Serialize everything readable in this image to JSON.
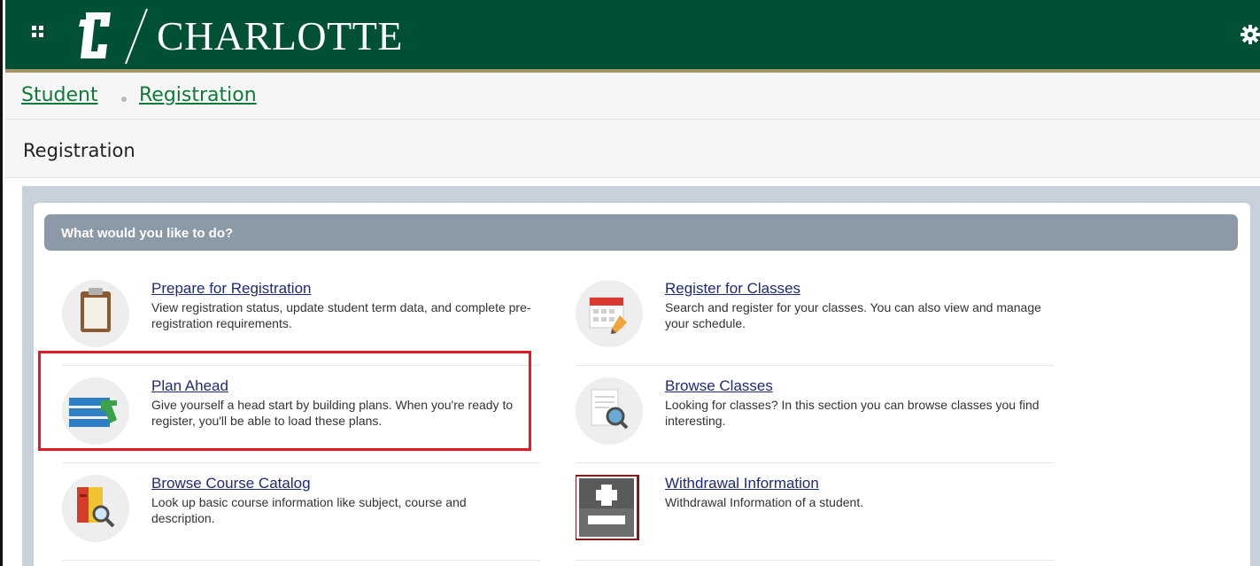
{
  "header": {
    "brand": "CHARLOTTE",
    "grid_icon": "app-grid-icon",
    "logo_icon": "university-c-logo-icon",
    "settings_icon": "gear-icon"
  },
  "breadcrumb": {
    "items": [
      {
        "label": "Student"
      },
      {
        "label": "Registration"
      }
    ]
  },
  "page": {
    "title": "Registration"
  },
  "section": {
    "title": "What would you like to do?"
  },
  "options": [
    {
      "label": "Prepare for Registration",
      "desc": "View registration status, update student term data, and complete pre-registration requirements.",
      "icon": "clipboard-icon"
    },
    {
      "label": "Register for Classes",
      "desc": "Search and register for your classes. You can also view and manage your schedule.",
      "icon": "calendar-pencil-icon"
    },
    {
      "label": "Plan Ahead",
      "desc": "Give yourself a head start by building plans. When you're ready to register, you'll be able to load these plans.",
      "icon": "plan-list-icon"
    },
    {
      "label": "Browse Classes",
      "desc": "Looking for classes? In this section you can browse classes you find interesting.",
      "icon": "document-search-icon"
    },
    {
      "label": "Browse Course Catalog",
      "desc": "Look up basic course information like subject, course and description.",
      "icon": "book-search-icon"
    },
    {
      "label": "Withdrawal Information",
      "desc": "Withdrawal Information of a student.",
      "icon": "plus-minus-icon"
    }
  ],
  "colors": {
    "brand_green": "#005035",
    "gold_stripe": "#a49665",
    "link_green": "#0f7a3a",
    "link_navy": "#1f2a78",
    "section_head": "#8c9aa7",
    "highlight_red": "#e21b24"
  }
}
